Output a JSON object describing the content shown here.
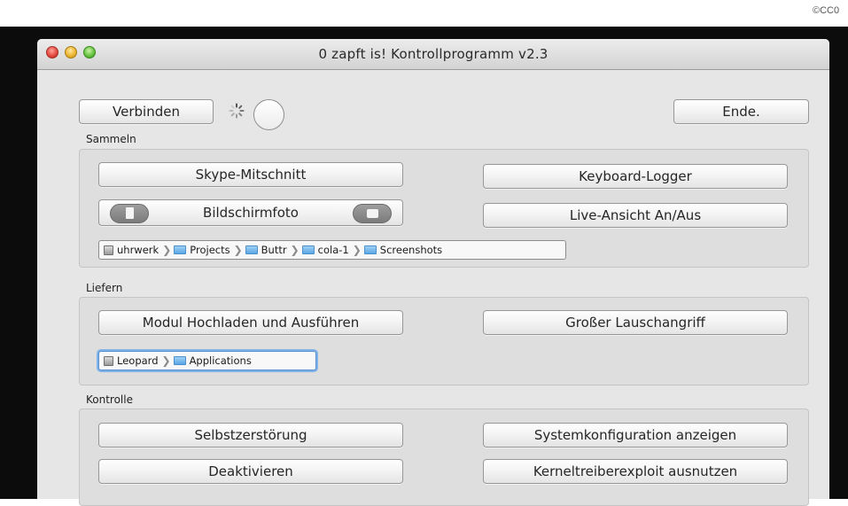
{
  "copyright": "©CC0",
  "window": {
    "title": "0 zapft is! Kontrollprogramm v2.3"
  },
  "top": {
    "connect": "Verbinden",
    "quit": "Ende."
  },
  "sections": {
    "collect": {
      "label": "Sammeln",
      "skype": "Skype-Mitschnitt",
      "keylogger": "Keyboard-Logger",
      "screenshot": "Bildschirmfoto",
      "liveview": "Live-Ansicht An/Aus",
      "path": [
        "uhrwerk",
        "Projects",
        "Buttr",
        "cola-1",
        "Screenshots"
      ]
    },
    "deliver": {
      "label": "Liefern",
      "upload": "Modul Hochladen und Ausführen",
      "eavesdrop": "Großer Lauschangriff",
      "path": [
        "Leopard",
        "Applications"
      ]
    },
    "control": {
      "label": "Kontrolle",
      "selfdestruct": "Selbstzerstörung",
      "sysconfig": "Systemkonfiguration anzeigen",
      "deactivate": "Deaktivieren",
      "kernelexploit": "Kerneltreiberexploit ausnutzen"
    }
  },
  "icons": {
    "spinner": "progress-spinner-icon",
    "disk": "disk-icon",
    "folder": "folder-icon"
  },
  "colors": {
    "window_bg": "#e6e6e6",
    "focus_ring": "#7fb2e8",
    "close": "#e0443a",
    "minimize": "#e9b129",
    "zoom": "#61c03b"
  }
}
